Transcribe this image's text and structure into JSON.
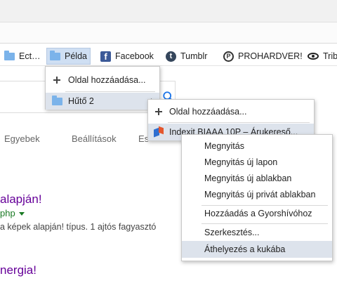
{
  "bookmarks_bar": {
    "items": [
      {
        "label": "Ect…",
        "icon": "folder-icon"
      },
      {
        "label": "Példa",
        "icon": "folder-icon"
      },
      {
        "label": "Facebook",
        "icon": "facebook-icon"
      },
      {
        "label": "Tumblr",
        "icon": "tumblr-icon"
      },
      {
        "label": "PROHARDVER!",
        "icon": "prohardver-icon"
      },
      {
        "label": "Trib",
        "icon": "tribe-icon"
      }
    ],
    "fb_glyph": "f",
    "tumblr_glyph": "t",
    "ph_glyph": "P"
  },
  "search_tabs": [
    "Egyebek",
    "Beállítások",
    "Es"
  ],
  "results": [
    {
      "title": "alapján!",
      "url": "php",
      "snippet": "a képek alapján! típus. 1 ajtós fagyasztó"
    },
    {
      "title": "nergia!",
      "url": "",
      "snippet": ""
    }
  ],
  "menu1": {
    "items": [
      {
        "label": "Oldal hozzáadása..."
      },
      {
        "label": "Hűtő 2"
      }
    ]
  },
  "menu2": {
    "items": [
      {
        "label": "Oldal hozzáadása..."
      },
      {
        "label": "Indexit BIAAA 10P – Árukereső..."
      }
    ]
  },
  "menu3": {
    "items": [
      {
        "label": "Megnyitás"
      },
      {
        "label": "Megnyitás új lapon"
      },
      {
        "label": "Megnyitás új ablakban"
      },
      {
        "label": "Megnyitás új privát ablakban"
      },
      {
        "label": "Hozzáadás a Gyorshívóhoz"
      },
      {
        "label": "Szerkesztés..."
      },
      {
        "label": "Áthelyezés a kukába"
      }
    ]
  },
  "colors": {
    "highlight": "#dde3ec",
    "visited_link": "#660099",
    "url_green": "#1a7a24",
    "search_blue": "#1a73e8"
  }
}
